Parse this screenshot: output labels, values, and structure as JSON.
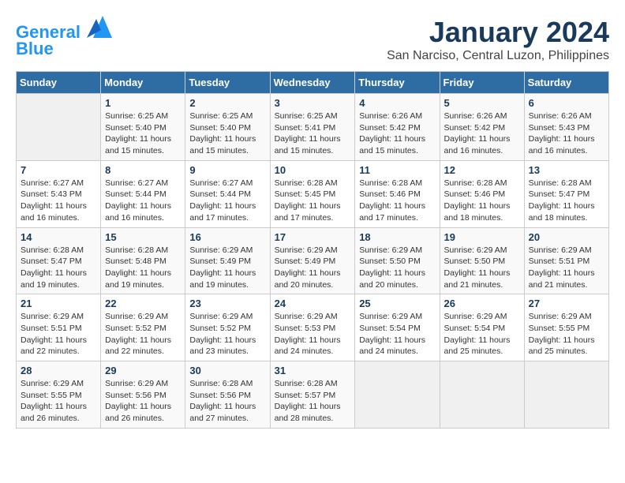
{
  "header": {
    "logo_line1": "General",
    "logo_line2": "Blue",
    "title": "January 2024",
    "subtitle": "San Narciso, Central Luzon, Philippines"
  },
  "columns": [
    "Sunday",
    "Monday",
    "Tuesday",
    "Wednesday",
    "Thursday",
    "Friday",
    "Saturday"
  ],
  "rows": [
    [
      {
        "day": "",
        "sunrise": "",
        "sunset": "",
        "daylight": ""
      },
      {
        "day": "1",
        "sunrise": "Sunrise: 6:25 AM",
        "sunset": "Sunset: 5:40 PM",
        "daylight": "Daylight: 11 hours and 15 minutes."
      },
      {
        "day": "2",
        "sunrise": "Sunrise: 6:25 AM",
        "sunset": "Sunset: 5:40 PM",
        "daylight": "Daylight: 11 hours and 15 minutes."
      },
      {
        "day": "3",
        "sunrise": "Sunrise: 6:25 AM",
        "sunset": "Sunset: 5:41 PM",
        "daylight": "Daylight: 11 hours and 15 minutes."
      },
      {
        "day": "4",
        "sunrise": "Sunrise: 6:26 AM",
        "sunset": "Sunset: 5:42 PM",
        "daylight": "Daylight: 11 hours and 15 minutes."
      },
      {
        "day": "5",
        "sunrise": "Sunrise: 6:26 AM",
        "sunset": "Sunset: 5:42 PM",
        "daylight": "Daylight: 11 hours and 16 minutes."
      },
      {
        "day": "6",
        "sunrise": "Sunrise: 6:26 AM",
        "sunset": "Sunset: 5:43 PM",
        "daylight": "Daylight: 11 hours and 16 minutes."
      }
    ],
    [
      {
        "day": "7",
        "sunrise": "Sunrise: 6:27 AM",
        "sunset": "Sunset: 5:43 PM",
        "daylight": "Daylight: 11 hours and 16 minutes."
      },
      {
        "day": "8",
        "sunrise": "Sunrise: 6:27 AM",
        "sunset": "Sunset: 5:44 PM",
        "daylight": "Daylight: 11 hours and 16 minutes."
      },
      {
        "day": "9",
        "sunrise": "Sunrise: 6:27 AM",
        "sunset": "Sunset: 5:44 PM",
        "daylight": "Daylight: 11 hours and 17 minutes."
      },
      {
        "day": "10",
        "sunrise": "Sunrise: 6:28 AM",
        "sunset": "Sunset: 5:45 PM",
        "daylight": "Daylight: 11 hours and 17 minutes."
      },
      {
        "day": "11",
        "sunrise": "Sunrise: 6:28 AM",
        "sunset": "Sunset: 5:46 PM",
        "daylight": "Daylight: 11 hours and 17 minutes."
      },
      {
        "day": "12",
        "sunrise": "Sunrise: 6:28 AM",
        "sunset": "Sunset: 5:46 PM",
        "daylight": "Daylight: 11 hours and 18 minutes."
      },
      {
        "day": "13",
        "sunrise": "Sunrise: 6:28 AM",
        "sunset": "Sunset: 5:47 PM",
        "daylight": "Daylight: 11 hours and 18 minutes."
      }
    ],
    [
      {
        "day": "14",
        "sunrise": "Sunrise: 6:28 AM",
        "sunset": "Sunset: 5:47 PM",
        "daylight": "Daylight: 11 hours and 19 minutes."
      },
      {
        "day": "15",
        "sunrise": "Sunrise: 6:28 AM",
        "sunset": "Sunset: 5:48 PM",
        "daylight": "Daylight: 11 hours and 19 minutes."
      },
      {
        "day": "16",
        "sunrise": "Sunrise: 6:29 AM",
        "sunset": "Sunset: 5:49 PM",
        "daylight": "Daylight: 11 hours and 19 minutes."
      },
      {
        "day": "17",
        "sunrise": "Sunrise: 6:29 AM",
        "sunset": "Sunset: 5:49 PM",
        "daylight": "Daylight: 11 hours and 20 minutes."
      },
      {
        "day": "18",
        "sunrise": "Sunrise: 6:29 AM",
        "sunset": "Sunset: 5:50 PM",
        "daylight": "Daylight: 11 hours and 20 minutes."
      },
      {
        "day": "19",
        "sunrise": "Sunrise: 6:29 AM",
        "sunset": "Sunset: 5:50 PM",
        "daylight": "Daylight: 11 hours and 21 minutes."
      },
      {
        "day": "20",
        "sunrise": "Sunrise: 6:29 AM",
        "sunset": "Sunset: 5:51 PM",
        "daylight": "Daylight: 11 hours and 21 minutes."
      }
    ],
    [
      {
        "day": "21",
        "sunrise": "Sunrise: 6:29 AM",
        "sunset": "Sunset: 5:51 PM",
        "daylight": "Daylight: 11 hours and 22 minutes."
      },
      {
        "day": "22",
        "sunrise": "Sunrise: 6:29 AM",
        "sunset": "Sunset: 5:52 PM",
        "daylight": "Daylight: 11 hours and 22 minutes."
      },
      {
        "day": "23",
        "sunrise": "Sunrise: 6:29 AM",
        "sunset": "Sunset: 5:52 PM",
        "daylight": "Daylight: 11 hours and 23 minutes."
      },
      {
        "day": "24",
        "sunrise": "Sunrise: 6:29 AM",
        "sunset": "Sunset: 5:53 PM",
        "daylight": "Daylight: 11 hours and 24 minutes."
      },
      {
        "day": "25",
        "sunrise": "Sunrise: 6:29 AM",
        "sunset": "Sunset: 5:54 PM",
        "daylight": "Daylight: 11 hours and 24 minutes."
      },
      {
        "day": "26",
        "sunrise": "Sunrise: 6:29 AM",
        "sunset": "Sunset: 5:54 PM",
        "daylight": "Daylight: 11 hours and 25 minutes."
      },
      {
        "day": "27",
        "sunrise": "Sunrise: 6:29 AM",
        "sunset": "Sunset: 5:55 PM",
        "daylight": "Daylight: 11 hours and 25 minutes."
      }
    ],
    [
      {
        "day": "28",
        "sunrise": "Sunrise: 6:29 AM",
        "sunset": "Sunset: 5:55 PM",
        "daylight": "Daylight: 11 hours and 26 minutes."
      },
      {
        "day": "29",
        "sunrise": "Sunrise: 6:29 AM",
        "sunset": "Sunset: 5:56 PM",
        "daylight": "Daylight: 11 hours and 26 minutes."
      },
      {
        "day": "30",
        "sunrise": "Sunrise: 6:28 AM",
        "sunset": "Sunset: 5:56 PM",
        "daylight": "Daylight: 11 hours and 27 minutes."
      },
      {
        "day": "31",
        "sunrise": "Sunrise: 6:28 AM",
        "sunset": "Sunset: 5:57 PM",
        "daylight": "Daylight: 11 hours and 28 minutes."
      },
      {
        "day": "",
        "sunrise": "",
        "sunset": "",
        "daylight": ""
      },
      {
        "day": "",
        "sunrise": "",
        "sunset": "",
        "daylight": ""
      },
      {
        "day": "",
        "sunrise": "",
        "sunset": "",
        "daylight": ""
      }
    ]
  ]
}
